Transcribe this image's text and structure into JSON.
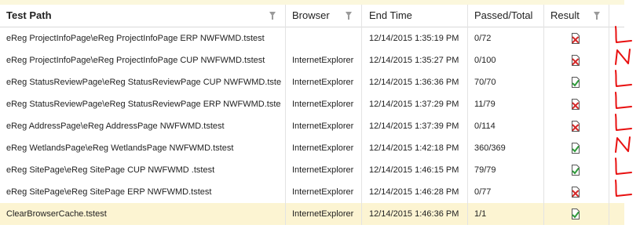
{
  "columns": [
    {
      "label": "Test Path"
    },
    {
      "label": "Browser"
    },
    {
      "label": "End Time"
    },
    {
      "label": "Passed/Total"
    },
    {
      "label": "Result"
    }
  ],
  "rows": [
    {
      "path": "eReg ProjectInfoPage\\eReg ProjectInfoPage ERP NWFWMD.tstest",
      "browser": "",
      "end_time": "12/14/2015 1:35:19 PM",
      "passed_total": "0/72",
      "result": "fail",
      "annotation": "L"
    },
    {
      "path": "eReg ProjectInfoPage\\eReg ProjectInfoPage CUP NWFWMD.tstest",
      "browser": "InternetExplorer",
      "end_time": "12/14/2015 1:35:27 PM",
      "passed_total": "0/100",
      "result": "fail",
      "annotation": "N"
    },
    {
      "path": "eReg StatusReviewPage\\eReg StatusReviewPage CUP NWFWMD.tstest",
      "browser": "InternetExplorer",
      "end_time": "12/14/2015 1:36:36 PM",
      "passed_total": "70/70",
      "result": "pass",
      "annotation": "L"
    },
    {
      "path": "eReg StatusReviewPage\\eReg StatusReviewPage ERP NWFWMD.tstest",
      "browser": "InternetExplorer",
      "end_time": "12/14/2015 1:37:29 PM",
      "passed_total": "11/79",
      "result": "fail",
      "annotation": "L"
    },
    {
      "path": "eReg AddressPage\\eReg AddressPage NWFWMD.tstest",
      "browser": "InternetExplorer",
      "end_time": "12/14/2015 1:37:39 PM",
      "passed_total": "0/114",
      "result": "fail",
      "annotation": "L"
    },
    {
      "path": "eReg WetlandsPage\\eReg WetlandsPage NWFWMD.tstest",
      "browser": "InternetExplorer",
      "end_time": "12/14/2015 1:42:18 PM",
      "passed_total": "360/369",
      "result": "pass",
      "annotation": "N"
    },
    {
      "path": "eReg SitePage\\eReg SitePage CUP NWFWMD .tstest",
      "browser": "InternetExplorer",
      "end_time": "12/14/2015 1:46:15 PM",
      "passed_total": "79/79",
      "result": "pass",
      "annotation": "L"
    },
    {
      "path": "eReg SitePage\\eReg SitePage ERP NWFWMD.tstest",
      "browser": "InternetExplorer",
      "end_time": "12/14/2015 1:46:28 PM",
      "passed_total": "0/77",
      "result": "fail",
      "annotation": "L"
    },
    {
      "path": "ClearBrowserCache.tstest",
      "browser": "InternetExplorer",
      "end_time": "12/14/2015 1:46:36 PM",
      "passed_total": "1/1",
      "result": "pass",
      "annotation": ""
    }
  ],
  "selected_row": 8,
  "icons": {
    "filter": "filter-icon",
    "pass": "pass-result-icon",
    "fail": "fail-result-icon"
  },
  "colors": {
    "selected_row": "#fcf4d2",
    "pass": "#2e9a3a",
    "fail": "#d42a2a",
    "annotation": "#e81010"
  }
}
